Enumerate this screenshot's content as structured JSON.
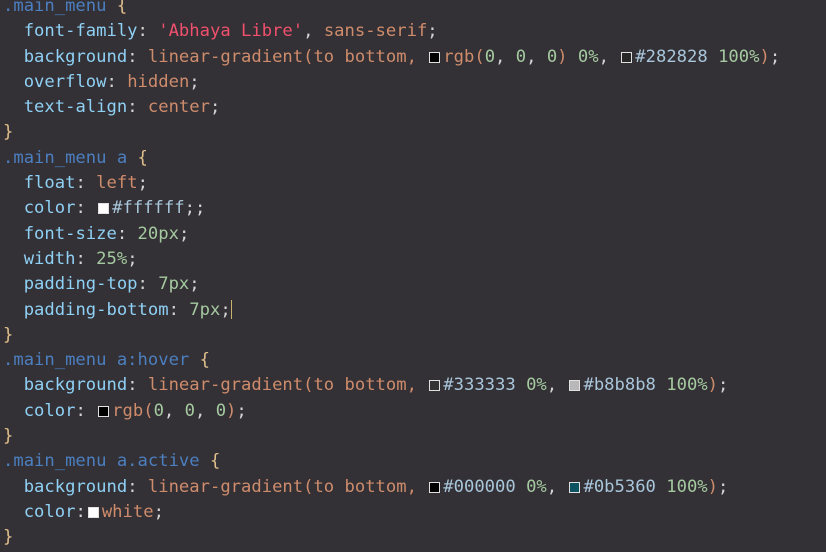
{
  "editor": {
    "language": "css",
    "lines": [
      [
        [
          "sel",
          ".main_menu "
        ],
        [
          "brace",
          "{"
        ]
      ],
      [
        [
          "punc",
          "  "
        ],
        [
          "prop",
          "font-family"
        ],
        [
          "punc",
          ": "
        ],
        [
          "str",
          "'Abhaya Libre'"
        ],
        [
          "punc",
          ", "
        ],
        [
          "val",
          "sans-serif"
        ],
        [
          "punc",
          ";"
        ]
      ],
      [
        [
          "punc",
          "  "
        ],
        [
          "prop",
          "background"
        ],
        [
          "punc",
          ": "
        ],
        [
          "val",
          "linear-gradient(to bottom, "
        ],
        [
          "swatch",
          "#000000"
        ],
        [
          "val",
          "rgb("
        ],
        [
          "num",
          "0"
        ],
        [
          "punc",
          ", "
        ],
        [
          "num",
          "0"
        ],
        [
          "punc",
          ", "
        ],
        [
          "num",
          "0"
        ],
        [
          "val",
          ")"
        ],
        [
          "num",
          " 0%"
        ],
        [
          "punc",
          ", "
        ],
        [
          "swatch",
          "#282828"
        ],
        [
          "hex",
          "#282828"
        ],
        [
          "num",
          " 100%"
        ],
        [
          "paren",
          ")"
        ],
        [
          "punc",
          ";"
        ]
      ],
      [
        [
          "punc",
          "  "
        ],
        [
          "prop",
          "overflow"
        ],
        [
          "punc",
          ": "
        ],
        [
          "val",
          "hidden"
        ],
        [
          "punc",
          ";"
        ]
      ],
      [
        [
          "punc",
          "  "
        ],
        [
          "prop",
          "text-align"
        ],
        [
          "punc",
          ": "
        ],
        [
          "val",
          "center"
        ],
        [
          "punc",
          ";"
        ]
      ],
      [
        [
          "brace",
          "}"
        ]
      ],
      [
        [
          "sel",
          ".main_menu a "
        ],
        [
          "brace",
          "{"
        ]
      ],
      [
        [
          "punc",
          "  "
        ],
        [
          "prop",
          "float"
        ],
        [
          "punc",
          ": "
        ],
        [
          "val",
          "left"
        ],
        [
          "punc",
          ";"
        ]
      ],
      [
        [
          "punc",
          "  "
        ],
        [
          "prop",
          "color"
        ],
        [
          "punc",
          ": "
        ],
        [
          "swatch",
          "#ffffff"
        ],
        [
          "hex",
          "#ffffff"
        ],
        [
          "punc",
          ";;"
        ]
      ],
      [
        [
          "punc",
          "  "
        ],
        [
          "prop",
          "font-size"
        ],
        [
          "punc",
          ": "
        ],
        [
          "num",
          "20px"
        ],
        [
          "punc",
          ";"
        ]
      ],
      [
        [
          "punc",
          "  "
        ],
        [
          "prop",
          "width"
        ],
        [
          "punc",
          ": "
        ],
        [
          "num",
          "25%"
        ],
        [
          "punc",
          ";"
        ]
      ],
      [
        [
          "punc",
          "  "
        ],
        [
          "prop",
          "padding-top"
        ],
        [
          "punc",
          ": "
        ],
        [
          "num",
          "7px"
        ],
        [
          "punc",
          ";"
        ]
      ],
      [
        [
          "punc",
          "  "
        ],
        [
          "prop",
          "padding-bottom"
        ],
        [
          "punc",
          ": "
        ],
        [
          "num",
          "7px"
        ],
        [
          "punc",
          ";"
        ],
        [
          "cursor",
          ""
        ]
      ],
      [
        [
          "brace",
          "}"
        ]
      ],
      [
        [
          "sel",
          ".main_menu a:hover "
        ],
        [
          "brace",
          "{"
        ]
      ],
      [
        [
          "punc",
          "  "
        ],
        [
          "prop",
          "background"
        ],
        [
          "punc",
          ": "
        ],
        [
          "val",
          "linear-gradient(to bottom, "
        ],
        [
          "swatch",
          "#333333"
        ],
        [
          "hex",
          "#333333"
        ],
        [
          "num",
          " 0%"
        ],
        [
          "punc",
          ", "
        ],
        [
          "swatch",
          "#b8b8b8"
        ],
        [
          "hex",
          "#b8b8b8"
        ],
        [
          "num",
          " 100%"
        ],
        [
          "paren",
          ")"
        ],
        [
          "punc",
          ";"
        ]
      ],
      [
        [
          "punc",
          "  "
        ],
        [
          "prop",
          "color"
        ],
        [
          "punc",
          ": "
        ],
        [
          "swatch",
          "#000000"
        ],
        [
          "val",
          "rgb("
        ],
        [
          "num",
          "0"
        ],
        [
          "punc",
          ", "
        ],
        [
          "num",
          "0"
        ],
        [
          "punc",
          ", "
        ],
        [
          "num",
          "0"
        ],
        [
          "val",
          ")"
        ],
        [
          "punc",
          ";"
        ]
      ],
      [
        [
          "brace",
          "}"
        ]
      ],
      [
        [
          "sel",
          ".main_menu a.active "
        ],
        [
          "brace",
          "{"
        ]
      ],
      [
        [
          "punc",
          "  "
        ],
        [
          "prop",
          "background"
        ],
        [
          "punc",
          ": "
        ],
        [
          "val",
          "linear-gradient(to bottom, "
        ],
        [
          "swatch",
          "#000000"
        ],
        [
          "hex",
          "#000000"
        ],
        [
          "num",
          " 0%"
        ],
        [
          "punc",
          ", "
        ],
        [
          "swatch",
          "#0b5360"
        ],
        [
          "hex",
          "#0b5360"
        ],
        [
          "num",
          " 100%"
        ],
        [
          "paren",
          ")"
        ],
        [
          "punc",
          ";"
        ]
      ],
      [
        [
          "punc",
          "  "
        ],
        [
          "prop",
          "color"
        ],
        [
          "punc",
          ":"
        ],
        [
          "swatch",
          "#ffffff"
        ],
        [
          "val",
          "white"
        ],
        [
          "punc",
          ";"
        ]
      ],
      [
        [
          "brace",
          "}"
        ]
      ]
    ]
  }
}
